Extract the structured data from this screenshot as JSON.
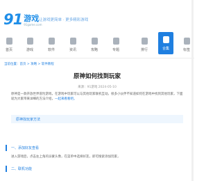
{
  "header": {
    "logo_num": "91",
    "logo_cn": "游戏",
    "logo_sub": "91game.com",
    "slogan": "让游戏更简单 · 更多精彩游戏"
  },
  "nav": {
    "items": [
      {
        "label": "首页",
        "icon": "home-icon"
      },
      {
        "label": "游戏",
        "icon": "gamepad-icon"
      },
      {
        "label": "软件",
        "icon": "app-icon"
      },
      {
        "label": "资讯",
        "icon": "news-icon"
      },
      {
        "label": "攻略",
        "icon": "book-icon"
      },
      {
        "label": "专题",
        "icon": "grid-icon"
      },
      {
        "label": "排行",
        "icon": "rank-icon"
      },
      {
        "label": "合集",
        "icon": "folder-icon"
      },
      {
        "label": "标签",
        "icon": "tag-icon"
      }
    ],
    "active_index": 7
  },
  "breadcrumb": "当前位置：首页 > 攻略 > 软件教程",
  "article": {
    "title": "原神如何找到玩家",
    "meta": "来源：91游戏 2024-05-10",
    "intro": "原神是一款开放世界冒险游戏，在游戏中玩家可以与其他玩家联机互动。很多小伙伴不知道如何在游戏中找到其他玩家，下面就为大家带来详细的方法介绍，",
    "intro_link": "一起来看看吧。",
    "guide": "原神找玩家方法",
    "sections": [
      "一、添加好友查看",
      "二、联机功能"
    ],
    "sec_paragraph": "进入游戏后，点击左上角的派蒙头像，在菜单中选择好友，即可搜索添加玩家，"
  },
  "colors": {
    "accent": "#1f7fe0",
    "brand": "#1f8ee8"
  }
}
